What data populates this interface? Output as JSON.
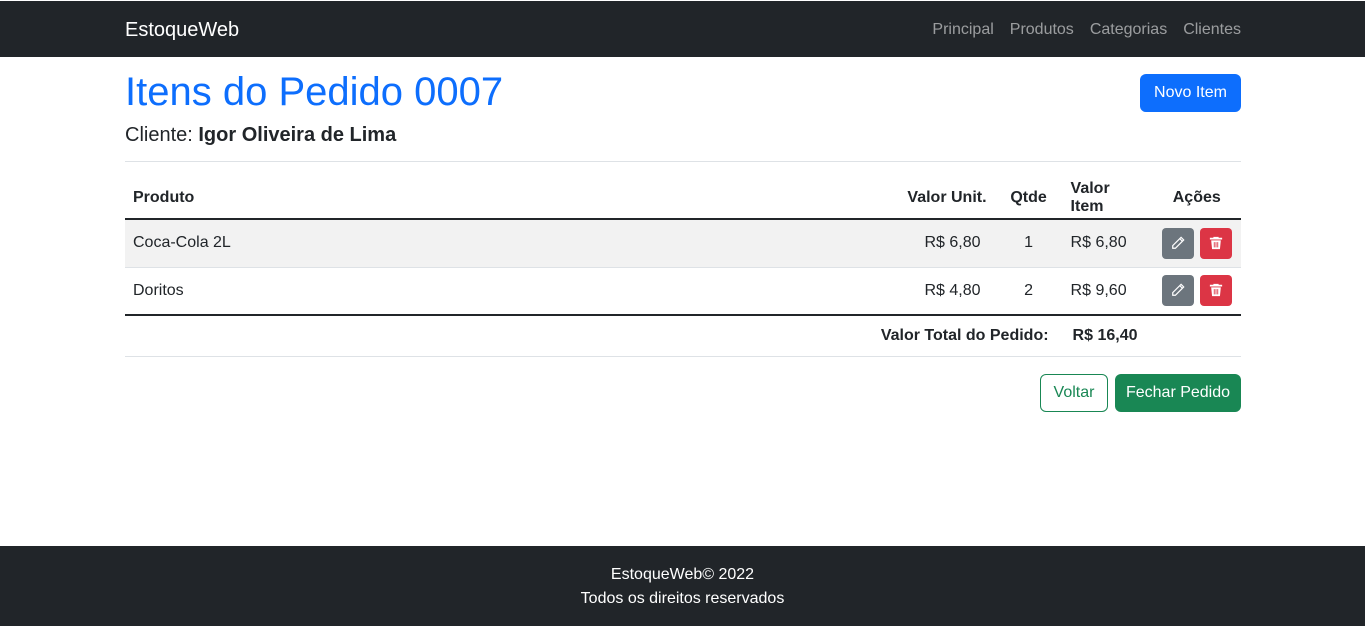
{
  "navbar": {
    "brand": "EstoqueWeb",
    "links": [
      "Principal",
      "Produtos",
      "Categorias",
      "Clientes"
    ]
  },
  "header": {
    "title": "Itens do Pedido 0007",
    "client_label": "Cliente:",
    "client_name": "Igor Oliveira de Lima",
    "new_item_label": "Novo Item"
  },
  "table": {
    "columns": [
      "Produto",
      "Valor Unit.",
      "Qtde",
      "Valor Item",
      "Ações"
    ],
    "rows": [
      {
        "produto": "Coca-Cola 2L",
        "valor_unit": "R$ 6,80",
        "qtde": "1",
        "valor_item": "R$ 6,80"
      },
      {
        "produto": "Doritos",
        "valor_unit": "R$ 4,80",
        "qtde": "2",
        "valor_item": "R$ 9,60"
      }
    ],
    "total_label": "Valor Total do Pedido:",
    "total_value": "R$ 16,40"
  },
  "buttons": {
    "back_label": "Voltar",
    "close_label": "Fechar Pedido"
  },
  "footer": {
    "line1": "EstoqueWeb© 2022",
    "line2": "Todos os direitos reservados"
  },
  "icons": {
    "edit": "pencil-icon",
    "delete": "trash-icon"
  },
  "colors": {
    "primary": "#0d6efd",
    "success": "#198754",
    "secondary": "#6c757d",
    "danger": "#dc3545",
    "dark": "#212529"
  }
}
